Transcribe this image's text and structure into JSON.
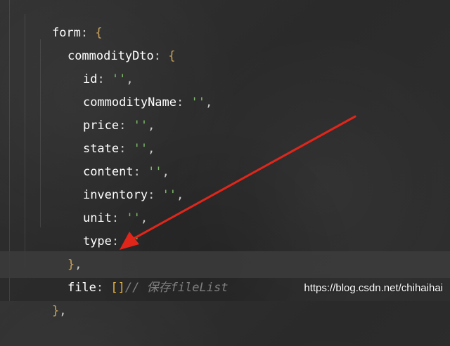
{
  "code": {
    "lines": [
      {
        "key": "form",
        "sep": ": ",
        "open": "{"
      },
      {
        "key": "commodityDto",
        "sep": ": ",
        "open": "{"
      },
      {
        "key": "id",
        "sep": ": ",
        "value": "''",
        "trail": ","
      },
      {
        "key": "commodityName",
        "sep": ": ",
        "value": "''",
        "trail": ","
      },
      {
        "key": "price",
        "sep": ": ",
        "value": "''",
        "trail": ","
      },
      {
        "key": "state",
        "sep": ": ",
        "value": "''",
        "trail": ","
      },
      {
        "key": "content",
        "sep": ": ",
        "value": "''",
        "trail": ","
      },
      {
        "key": "inventory",
        "sep": ": ",
        "value": "''",
        "trail": ","
      },
      {
        "key": "unit",
        "sep": ": ",
        "value": "''",
        "trail": ","
      },
      {
        "key": "type",
        "sep": ": ",
        "value": "''",
        "trail": ""
      },
      {
        "close": "}",
        "trail": ","
      },
      {
        "key": "file",
        "sep": ": ",
        "bracket": "[]",
        "comment": "// 保存fileList"
      },
      {
        "close": "}",
        "trail": ","
      }
    ]
  },
  "colors": {
    "arrow": "#e0261b",
    "background": "#2b2b2b",
    "string": "#7fbf6a",
    "brace": "#c9a25a",
    "comment": "#808080"
  },
  "watermark": {
    "text": "https://blog.csdn.net/chihaihai"
  }
}
